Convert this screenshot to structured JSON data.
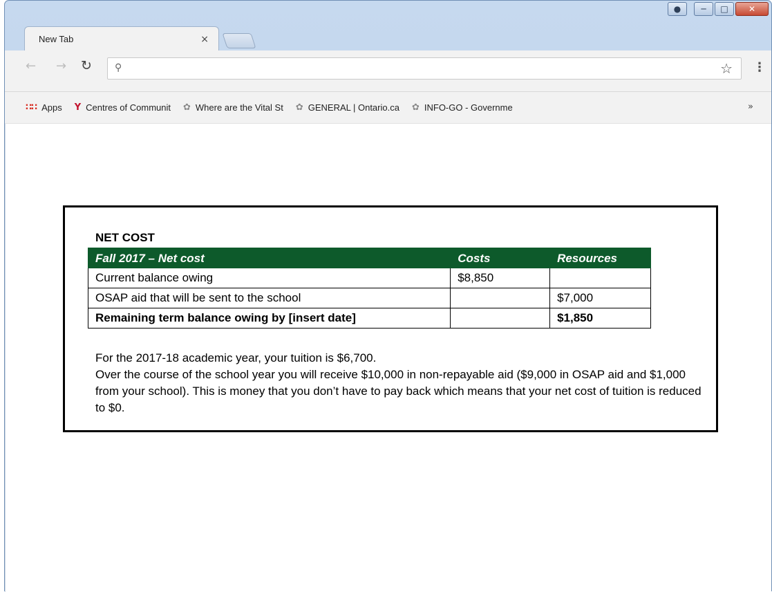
{
  "browser": {
    "tab_title": "New Tab",
    "tab_close": "×",
    "omnibox": {
      "value": "",
      "placeholder": ""
    },
    "bookmarks": [
      {
        "label": "Apps",
        "icon": "apps-grid-icon"
      },
      {
        "label": "Centres of Communit",
        "icon": "centres-logo-icon"
      },
      {
        "label": "Where are the Vital St",
        "icon": "trillium-icon"
      },
      {
        "label": "GENERAL | Ontario.ca",
        "icon": "trillium-icon"
      },
      {
        "label": "INFO-GO - Governme",
        "icon": "trillium-icon"
      }
    ],
    "bookmarks_more": "»"
  },
  "notice": {
    "title": "NET COST",
    "table": {
      "headers": [
        "Fall 2017 – Net cost",
        "Costs",
        "Resources"
      ],
      "rows": [
        [
          "Current balance owing",
          "$8,850",
          ""
        ],
        [
          "OSAP aid that will be sent to the school",
          "",
          "$7,000"
        ],
        [
          "Remaining term balance owing by [insert date]",
          "",
          "$1,850"
        ]
      ]
    },
    "paragraph_1": "For the 2017-18 academic year, your tuition is $6,700.",
    "paragraph_2": "Over the course of the school year you will receive $10,000 in non-repayable aid ($9,000 in OSAP aid and $1,000 from your school). This is money that you don’t have to pay back which means that your net cost of tuition is reduced to $0."
  },
  "colors": {
    "table_header_bg": "#0d5a2b",
    "table_header_text": "#ffffff"
  }
}
